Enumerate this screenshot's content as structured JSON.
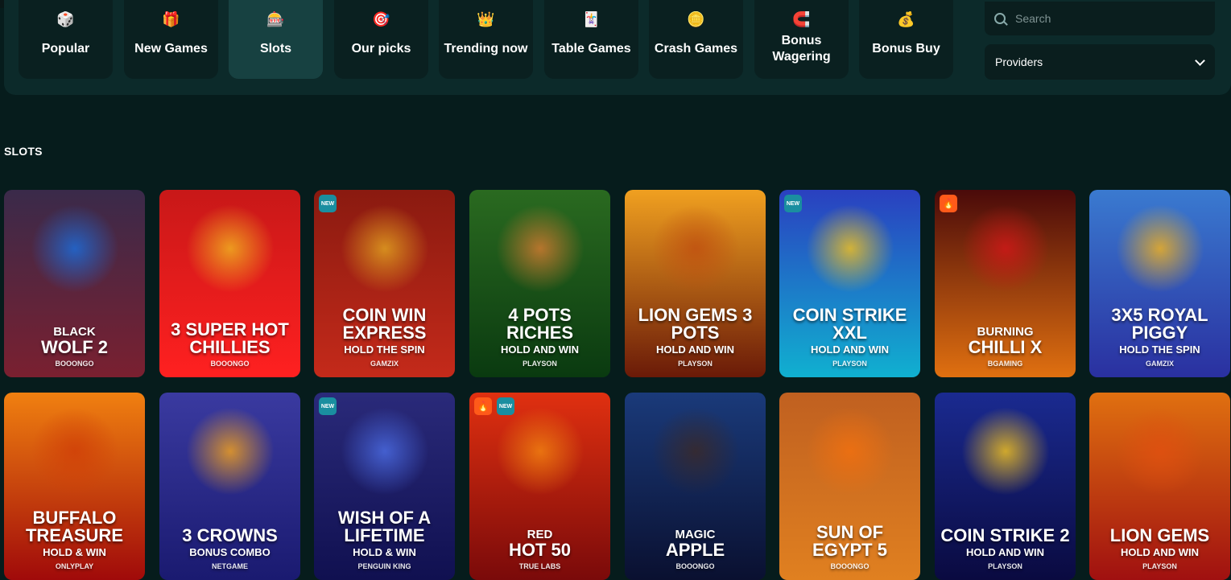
{
  "categories": [
    {
      "label": "Popular",
      "icon": "dice-icon",
      "glyph": "🎲"
    },
    {
      "label": "New Games",
      "icon": "gift-icon",
      "glyph": "🎁"
    },
    {
      "label": "Slots",
      "icon": "slot-777-icon",
      "glyph": "🎰"
    },
    {
      "label": "Our picks",
      "icon": "target-icon",
      "glyph": "🎯"
    },
    {
      "label": "Trending now",
      "icon": "crown-icon",
      "glyph": "👑"
    },
    {
      "label": "Table Games",
      "icon": "cards-icon",
      "glyph": "🃏"
    },
    {
      "label": "Crash Games",
      "icon": "chip-icon",
      "glyph": "🪙"
    },
    {
      "label": "Bonus Wagering",
      "icon": "horseshoe-icon",
      "glyph": "🧲"
    },
    {
      "label": "Bonus Buy",
      "icon": "bonus-icon",
      "glyph": "💰"
    }
  ],
  "search": {
    "placeholder": "Search"
  },
  "providers": {
    "label": "Providers"
  },
  "section_title": "SLOTS",
  "games": [
    {
      "pre": "BLACK",
      "title": "WOLF 2",
      "sub": "",
      "provider": "BOOONGO",
      "bg": "#3a2a4a",
      "bg2": "#7a2030",
      "art": "#1d6bd8",
      "badges": []
    },
    {
      "pre": "",
      "title": "3 SUPER HOT CHILLIES",
      "sub": "",
      "provider": "BOOONGO",
      "bg": "#c81818",
      "bg2": "#ff2020",
      "art": "#f0b020",
      "badges": []
    },
    {
      "pre": "",
      "title": "COIN WIN EXPRESS",
      "sub": "HOLD THE SPIN",
      "provider": "GAMZIX",
      "bg": "#8a1a10",
      "bg2": "#c42a1a",
      "art": "#e0a020",
      "badges": [
        "NEW"
      ]
    },
    {
      "pre": "",
      "title": "4 POTS RICHES",
      "sub": "HOLD AND WIN",
      "provider": "PLAYSON",
      "bg": "#2a6a20",
      "bg2": "#0a3a10",
      "art": "#d07a30",
      "badges": []
    },
    {
      "pre": "",
      "title": "LION GEMS 3 POTS",
      "sub": "HOLD AND WIN",
      "provider": "PLAYSON",
      "bg": "#f0a020",
      "bg2": "#6a1a08",
      "art": "#c05010",
      "badges": []
    },
    {
      "pre": "",
      "title": "COIN STRIKE XXL",
      "sub": "HOLD AND WIN",
      "provider": "PLAYSON",
      "bg": "#2a40c0",
      "bg2": "#10b0d0",
      "art": "#f0c020",
      "badges": [
        "NEW"
      ]
    },
    {
      "pre": "BURNING",
      "title": "CHILLI X",
      "sub": "",
      "provider": "BGAMING",
      "bg": "#4a0a0a",
      "bg2": "#e07010",
      "art": "#d01818",
      "badges": [
        "HOT"
      ]
    },
    {
      "pre": "",
      "title": "3X5 ROYAL PIGGY",
      "sub": "HOLD THE SPIN",
      "provider": "GAMZIX",
      "bg": "#3a7ad0",
      "bg2": "#2a30a0",
      "art": "#f0b020",
      "badges": []
    },
    {
      "pre": "",
      "title": "BUFFALO TREASURE",
      "sub": "HOLD & WIN",
      "provider": "ONLYPLAY",
      "bg": "#f08010",
      "bg2": "#a00a0a",
      "art": "#d04008",
      "badges": []
    },
    {
      "pre": "",
      "title": "3 CROWNS",
      "sub": "BONUS COMBO",
      "provider": "NETGAME",
      "bg": "#3a3aa0",
      "bg2": "#1a1a70",
      "art": "#f0a020",
      "badges": []
    },
    {
      "pre": "",
      "title": "WISH OF A LIFETIME",
      "sub": "HOLD & WIN",
      "provider": "PENGUIN KING",
      "bg": "#2a2a7a",
      "bg2": "#101050",
      "art": "#4a6ae0",
      "badges": [
        "NEW"
      ]
    },
    {
      "pre": "RED",
      "title": "HOT 50",
      "sub": "",
      "provider": "TRUE LABS",
      "bg": "#e03010",
      "bg2": "#7a0a0a",
      "art": "#f08010",
      "badges": [
        "HOT",
        "NEW"
      ]
    },
    {
      "pre": "MAGIC",
      "title": "APPLE",
      "sub": "",
      "provider": "BOOONGO",
      "bg": "#1a3a7a",
      "bg2": "#0a1030",
      "art": "#3a2a2a",
      "badges": []
    },
    {
      "pre": "",
      "title": "SUN OF EGYPT 5",
      "sub": "",
      "provider": "BOOONGO",
      "bg": "#c06020",
      "bg2": "#e08020",
      "art": "#f07010",
      "badges": []
    },
    {
      "pre": "",
      "title": "COIN STRIKE 2",
      "sub": "HOLD AND WIN",
      "provider": "PLAYSON",
      "bg": "#1a2a90",
      "bg2": "#0a0a40",
      "art": "#f0c020",
      "badges": []
    },
    {
      "pre": "",
      "title": "LION GEMS",
      "sub": "HOLD AND WIN",
      "provider": "PLAYSON",
      "bg": "#e07010",
      "bg2": "#a01010",
      "art": "#e05010",
      "badges": []
    }
  ]
}
